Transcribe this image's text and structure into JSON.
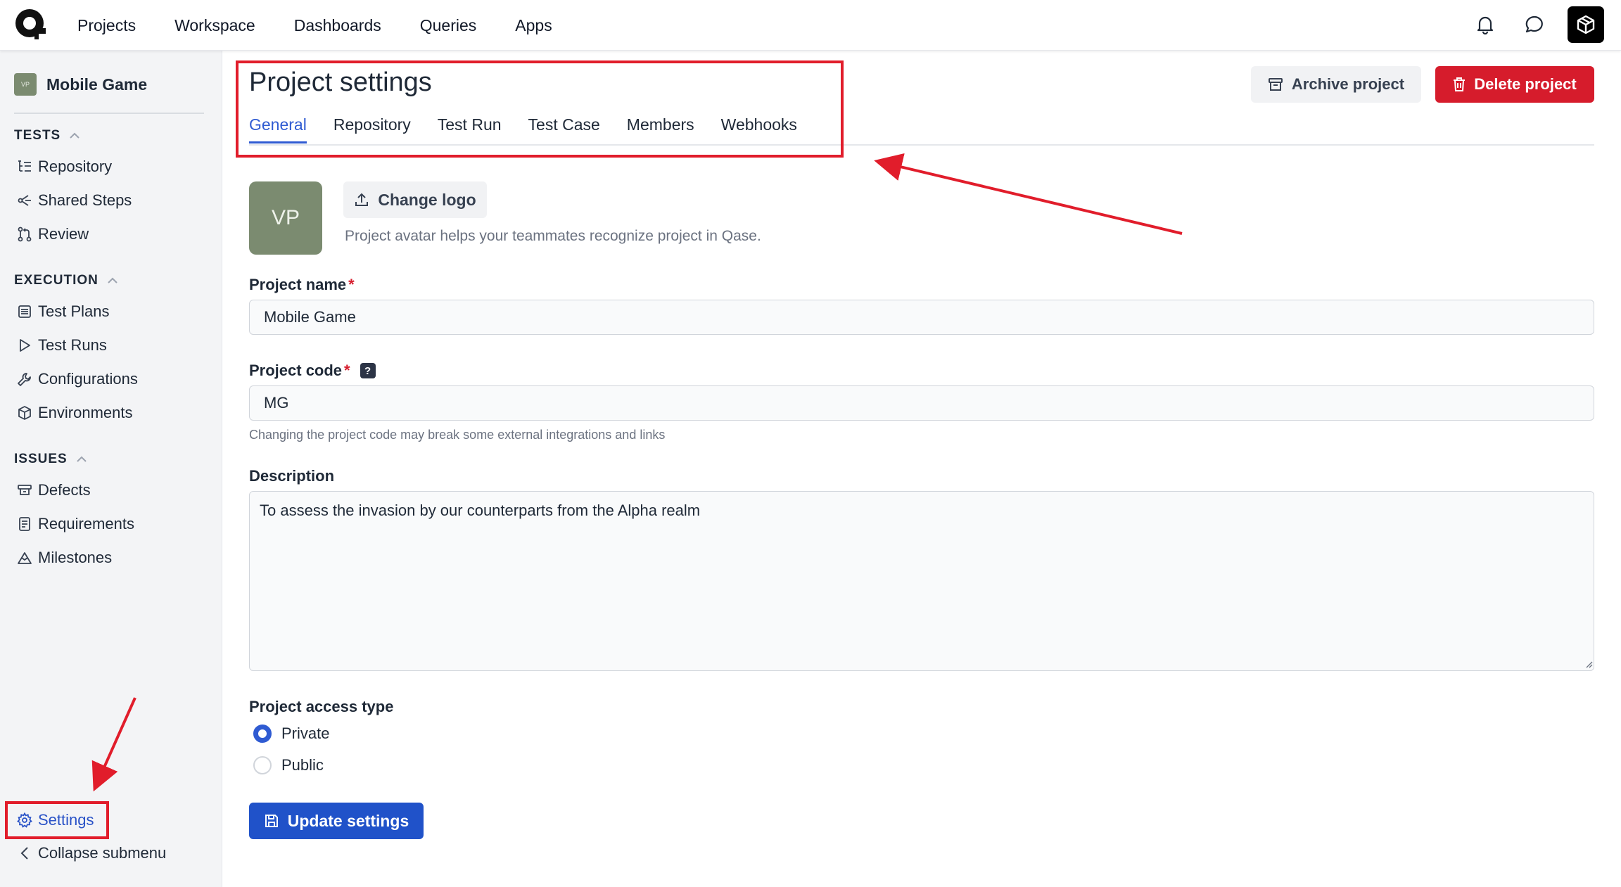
{
  "topnav": {
    "items": [
      "Projects",
      "Workspace",
      "Dashboards",
      "Queries",
      "Apps"
    ]
  },
  "sidebar": {
    "project_avatar": "VP",
    "project_name": "Mobile Game",
    "sections": {
      "tests": "TESTS",
      "execution": "EXECUTION",
      "issues": "ISSUES"
    },
    "items": {
      "repository": "Repository",
      "shared_steps": "Shared Steps",
      "review": "Review",
      "test_plans": "Test Plans",
      "test_runs": "Test Runs",
      "configurations": "Configurations",
      "environments": "Environments",
      "defects": "Defects",
      "requirements": "Requirements",
      "milestones": "Milestones",
      "settings": "Settings",
      "collapse": "Collapse submenu"
    }
  },
  "header": {
    "title": "Project settings",
    "tabs": [
      "General",
      "Repository",
      "Test Run",
      "Test Case",
      "Members",
      "Webhooks"
    ],
    "active_tab": "General",
    "archive_label": "Archive project",
    "delete_label": "Delete project"
  },
  "form": {
    "avatar": "VP",
    "change_logo_label": "Change logo",
    "avatar_help": "Project avatar helps your teammates recognize project in Qase.",
    "project_name_label": "Project name",
    "project_name_value": "Mobile Game",
    "project_code_label": "Project code",
    "project_code_value": "MG",
    "code_hint": "Changing the project code may break some external integrations and links",
    "description_label": "Description",
    "description_value": "To assess the invasion by our counterparts from the Alpha realm",
    "access_label": "Project access type",
    "access_options": [
      "Private",
      "Public"
    ],
    "access_selected": "Private",
    "required_mark": "*",
    "help_mark": "?",
    "update_label": "Update settings"
  },
  "colors": {
    "accent": "#2f5bd2",
    "danger": "#d61c2c",
    "annotation": "#e11d2b",
    "avatar": "#7b8b70"
  }
}
